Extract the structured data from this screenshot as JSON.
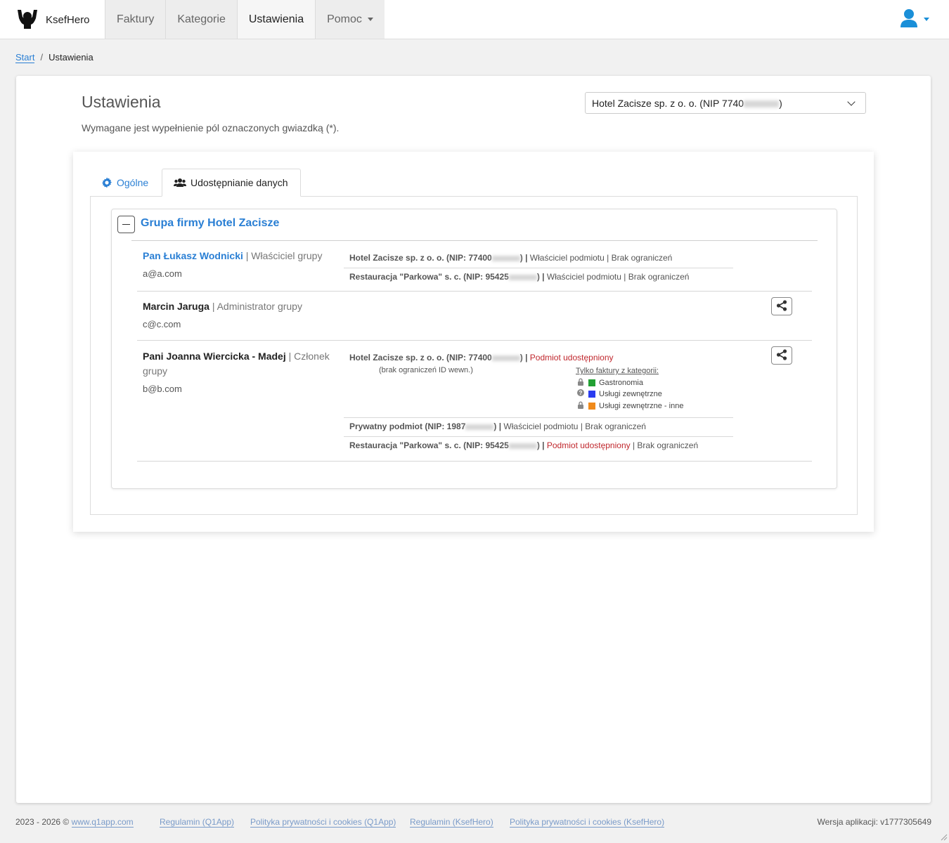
{
  "app": {
    "name": "KsefHero"
  },
  "nav": {
    "items": [
      {
        "label": "Faktury"
      },
      {
        "label": "Kategorie"
      },
      {
        "label": "Ustawienia"
      },
      {
        "label": "Pomoc"
      }
    ]
  },
  "breadcrumb": {
    "start": "Start",
    "current": "Ustawienia"
  },
  "page": {
    "title": "Ustawienia",
    "subtitle": "Wymagane jest wypełnienie pól oznaczonych gwiazdką (*).",
    "company_select_value": "Hotel Zacisze sp. z o. o. (NIP 7740"
  },
  "tabs": {
    "general": "Ogólne",
    "sharing": "Udostępnianie danych"
  },
  "group": {
    "title": "Grupa firmy Hotel Zacisze",
    "members": [
      {
        "name": "Pan Łukasz Wodnicki",
        "role": "| Właściciel grupy",
        "email": "a@a.com",
        "entities": [
          {
            "name": "Hotel Zacisze sp. z o. o. (NIP: 77400",
            "sep": "|",
            "status": "Właściciel podmiotu",
            "limit": "| Brak ograniczeń"
          },
          {
            "name": "Restauracja \"Parkowa\" s. c. (NIP: 95425",
            "sep": "|",
            "status": "Właściciel podmiotu",
            "limit": "| Brak ograniczeń"
          }
        ]
      },
      {
        "name": "Marcin Jaruga",
        "role": "| Administrator grupy",
        "email": "c@c.com",
        "entities": []
      },
      {
        "name": "Pani Joanna Wiercicka - Madej",
        "role": "| Członek grupy",
        "email": "b@b.com",
        "entities": [
          {
            "name": "Hotel Zacisze sp. z o. o. (NIP: 77400",
            "sep": "|",
            "status": "Podmiot udostępniony",
            "limit": "",
            "note": "(brak ograniczeń ID wewn.)",
            "categories_header": "Tylko faktury z kategorii:",
            "categories": [
              {
                "label": "Gastronomia",
                "color": "#22a033",
                "icon": "lock-icon"
              },
              {
                "label": "Usługi zewnętrzne",
                "color": "#2a3cf0",
                "icon": "question-icon"
              },
              {
                "label": "Usługi zewnętrzne - inne",
                "color": "#f08a1a",
                "icon": "lock-icon"
              }
            ]
          },
          {
            "name": "Prywatny podmiot (NIP: 1987",
            "sep": "|",
            "status": "Właściciel podmiotu",
            "limit": "| Brak ograniczeń"
          },
          {
            "name": "Restauracja \"Parkowa\" s. c. (NIP: 95425",
            "sep": "|",
            "status": "Podmiot udostępniony",
            "limit": "| Brak ograniczeń"
          }
        ]
      }
    ]
  },
  "footer": {
    "copyright": "2023 - 2026 ©",
    "site_link": "www.q1app.com",
    "links": [
      "Regulamin (Q1App)",
      "Polityka prywatności i cookies (Q1App)",
      "Regulamin (KsefHero)",
      "Polityka prywatności i cookies (KsefHero)"
    ],
    "version": "Wersja aplikacji: v1777305649"
  },
  "colors": {
    "accent": "#2a7fd4",
    "shared": "#c0272d"
  }
}
